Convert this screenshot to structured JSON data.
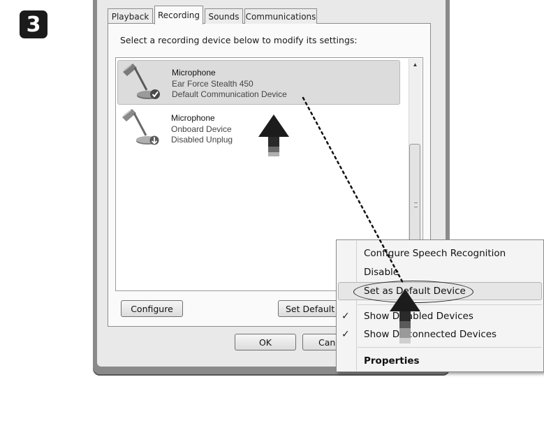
{
  "step": {
    "number": "3"
  },
  "tabs": [
    {
      "label": "Playback",
      "active": false
    },
    {
      "label": "Recording",
      "active": true
    },
    {
      "label": "Sounds",
      "active": false
    },
    {
      "label": "Communications",
      "active": false
    }
  ],
  "instruction": "Select a recording device below to modify its settings:",
  "devices": [
    {
      "name": "Microphone",
      "line2": "Ear Force Stealth 450",
      "line3": "Default Communication Device",
      "selected": true,
      "icon": "microphone-icon",
      "status_icon": "green-check-badge"
    },
    {
      "name": "Microphone",
      "line2": "Onboard Device",
      "line3": "Disabled Unplug",
      "selected": false,
      "icon": "microphone-icon",
      "status_icon": "down-arrow-badge"
    }
  ],
  "scrollbar": {
    "up_arrow": "▲",
    "grip": "≡"
  },
  "buttons": {
    "configure": "Configure",
    "set_default": "Set Default",
    "ok": "OK",
    "cancel": "Can"
  },
  "context_menu": {
    "items": [
      {
        "label": "Configure Speech Recognition",
        "checked": false,
        "bold": false
      },
      {
        "label": "Disable",
        "checked": false,
        "bold": false
      },
      {
        "label": "Set as Default Device",
        "checked": false,
        "bold": false,
        "highlighted": true
      },
      {
        "label": "Show Disabled Devices",
        "checked": true,
        "bold": false
      },
      {
        "label": "Show Disconnected Devices",
        "checked": true,
        "bold": false
      },
      {
        "label": "Properties",
        "checked": false,
        "bold": true
      }
    ],
    "check_glyph": "✓"
  },
  "colors": {
    "selection_bg": "#dcdcdc",
    "annotation": "#222222"
  }
}
